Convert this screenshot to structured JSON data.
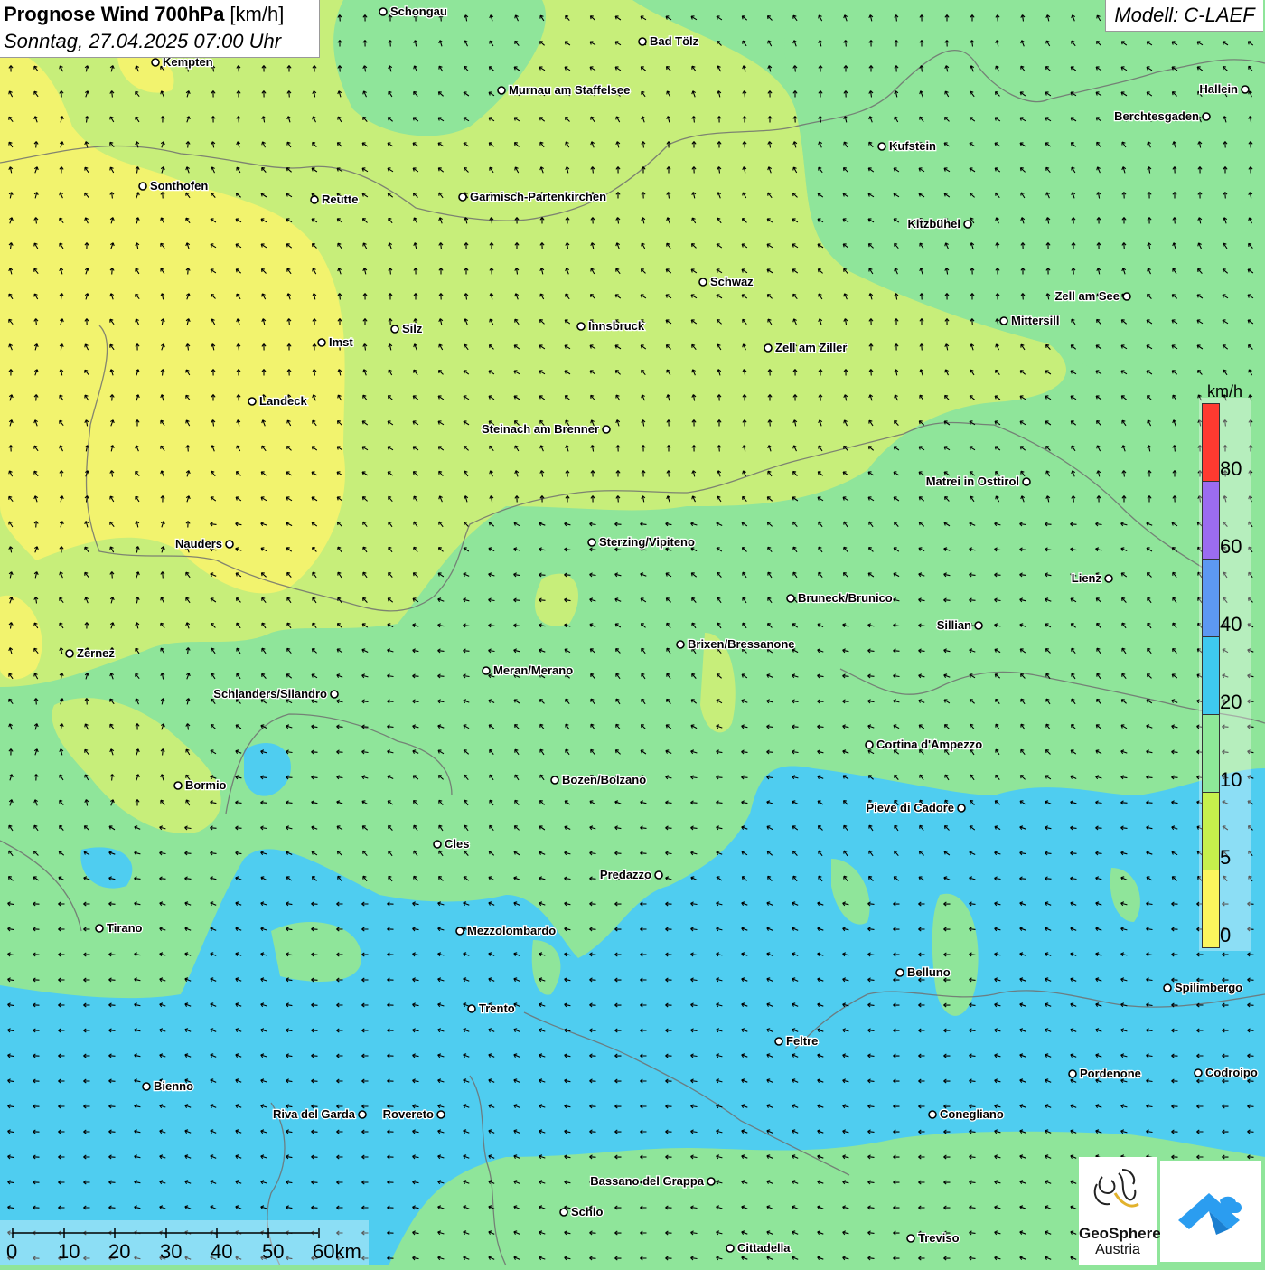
{
  "header": {
    "title": "Prognose Wind 700hPa",
    "unit": " [km/h]",
    "datetime": "Sonntag, 27.04.2025 07:00 Uhr",
    "model": "Modell: C-LAEF"
  },
  "legend": {
    "unit": "km/h",
    "labels": [
      "80",
      "60",
      "40",
      "20",
      "10",
      "5",
      "0"
    ],
    "colors": [
      "#ff3a30",
      "#9b6cf0",
      "#5d98f2",
      "#3ec9ef",
      "#8ee898",
      "#c6f04c",
      "#fbf55d"
    ]
  },
  "scale_bar": {
    "labels": [
      "0",
      "10",
      "20",
      "30",
      "40",
      "50",
      "60km"
    ]
  },
  "logo": {
    "name": "GeoSphere",
    "sub": "Austria"
  },
  "cities": [
    {
      "name": "Schongau",
      "side": "right"
    },
    {
      "name": "Bad Tölz",
      "side": "right"
    },
    {
      "name": "Kempten",
      "side": "right"
    },
    {
      "name": "Murnau am Staffelsee",
      "side": "right"
    },
    {
      "name": "Hallein",
      "side": "left"
    },
    {
      "name": "Berchtesgaden",
      "side": "left"
    },
    {
      "name": "Kufstein",
      "side": "right"
    },
    {
      "name": "Sonthofen",
      "side": "right"
    },
    {
      "name": "Reutte",
      "side": "right"
    },
    {
      "name": "Garmisch-Partenkirchen",
      "side": "right"
    },
    {
      "name": "Kitzbühel",
      "side": "left"
    },
    {
      "name": "Schwaz",
      "side": "right"
    },
    {
      "name": "Zell am See",
      "side": "left"
    },
    {
      "name": "Mittersill",
      "side": "right"
    },
    {
      "name": "Innsbruck",
      "side": "right"
    },
    {
      "name": "Silz",
      "side": "right"
    },
    {
      "name": "Imst",
      "side": "right"
    },
    {
      "name": "Zell am Ziller",
      "side": "right"
    },
    {
      "name": "Landeck",
      "side": "right"
    },
    {
      "name": "Steinach am Brenner",
      "side": "left"
    },
    {
      "name": "Matrei in Osttirol",
      "side": "left"
    },
    {
      "name": "Nauders",
      "side": "left"
    },
    {
      "name": "Sterzing/Vipiteno",
      "side": "right"
    },
    {
      "name": "Lienz",
      "side": "left"
    },
    {
      "name": "Bruneck/Brunico",
      "side": "right"
    },
    {
      "name": "Sillian",
      "side": "left"
    },
    {
      "name": "Zernez",
      "side": "right"
    },
    {
      "name": "Brixen/Bressanone",
      "side": "right"
    },
    {
      "name": "Meran/Merano",
      "side": "right"
    },
    {
      "name": "Schlanders/Silandro",
      "side": "left"
    },
    {
      "name": "Cortina d'Ampezzo",
      "side": "right"
    },
    {
      "name": "Bozen/Bolzano",
      "side": "right"
    },
    {
      "name": "Bormio",
      "side": "right"
    },
    {
      "name": "Pieve di Cadore",
      "side": "left"
    },
    {
      "name": "Cles",
      "side": "right"
    },
    {
      "name": "Predazzo",
      "side": "left"
    },
    {
      "name": "Tirano",
      "side": "right"
    },
    {
      "name": "Mezzolombardo",
      "side": "right"
    },
    {
      "name": "Belluno",
      "side": "right"
    },
    {
      "name": "Spilimbergo",
      "side": "right"
    },
    {
      "name": "Trento",
      "side": "right"
    },
    {
      "name": "Feltre",
      "side": "right"
    },
    {
      "name": "Pordenone",
      "side": "right"
    },
    {
      "name": "Codroipo",
      "side": "right"
    },
    {
      "name": "Bienno",
      "side": "right"
    },
    {
      "name": "Riva del Garda",
      "side": "left"
    },
    {
      "name": "Rovereto",
      "side": "left"
    },
    {
      "name": "Conegliano",
      "side": "right"
    },
    {
      "name": "Bassano del Grappa",
      "side": "left"
    },
    {
      "name": "Schio",
      "side": "right"
    },
    {
      "name": "Treviso",
      "side": "right"
    },
    {
      "name": "Cittadella",
      "side": "right"
    }
  ]
}
